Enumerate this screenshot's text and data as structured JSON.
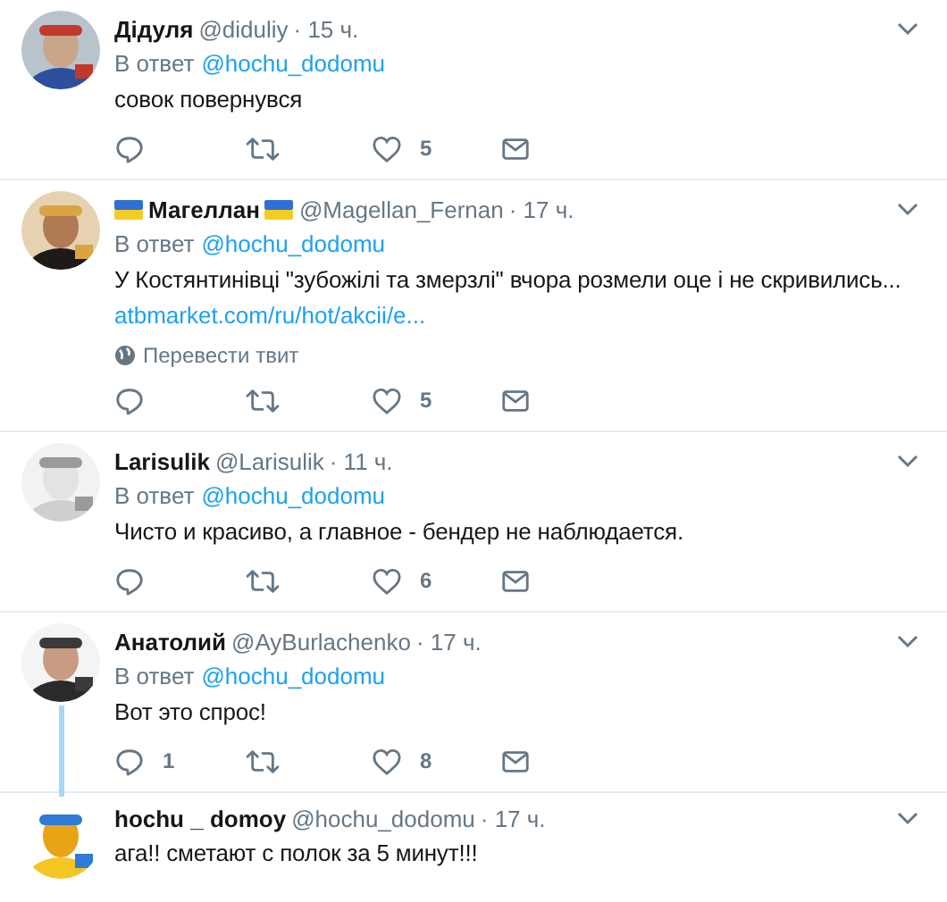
{
  "tweets": [
    {
      "name": "Дідуля",
      "handle": "@diduliy",
      "time": "· 15 ч.",
      "reply_label": "В ответ",
      "reply_to": "@hochu_dodomu",
      "text": "совок повернувся",
      "actions": {
        "likes": "5"
      }
    },
    {
      "name": "Магеллан",
      "flags": true,
      "handle": "@Magellan_Fernan",
      "time": "· 17 ч.",
      "reply_label": "В ответ",
      "reply_to": "@hochu_dodomu",
      "text": "У Костянтинівці \"зубожілі та змерзлі\" вчора розмели оце і не скривились...",
      "link": "atbmarket.com/ru/hot/akcii/e...",
      "translate": "Перевести твит",
      "actions": {
        "likes": "5"
      }
    },
    {
      "name": "Larisulik",
      "handle": "@Larisulik",
      "time": "· 11 ч.",
      "reply_label": "В ответ",
      "reply_to": "@hochu_dodomu",
      "text": "Чисто и красиво, а главное - бендер не наблюдается.",
      "actions": {
        "likes": "6"
      }
    },
    {
      "name": "Анатолий",
      "handle": "@AyBurlachenko",
      "time": "· 17 ч.",
      "reply_label": "В ответ",
      "reply_to": "@hochu_dodomu",
      "text": "Вот это спрос!",
      "actions": {
        "replies": "1",
        "likes": "8"
      },
      "thread_line": true
    },
    {
      "name": "hochu _ domoy",
      "handle": "@hochu_dodomu",
      "time": "· 17 ч.",
      "text": "ага!! сметают с полок за 5 минут!!!"
    }
  ]
}
